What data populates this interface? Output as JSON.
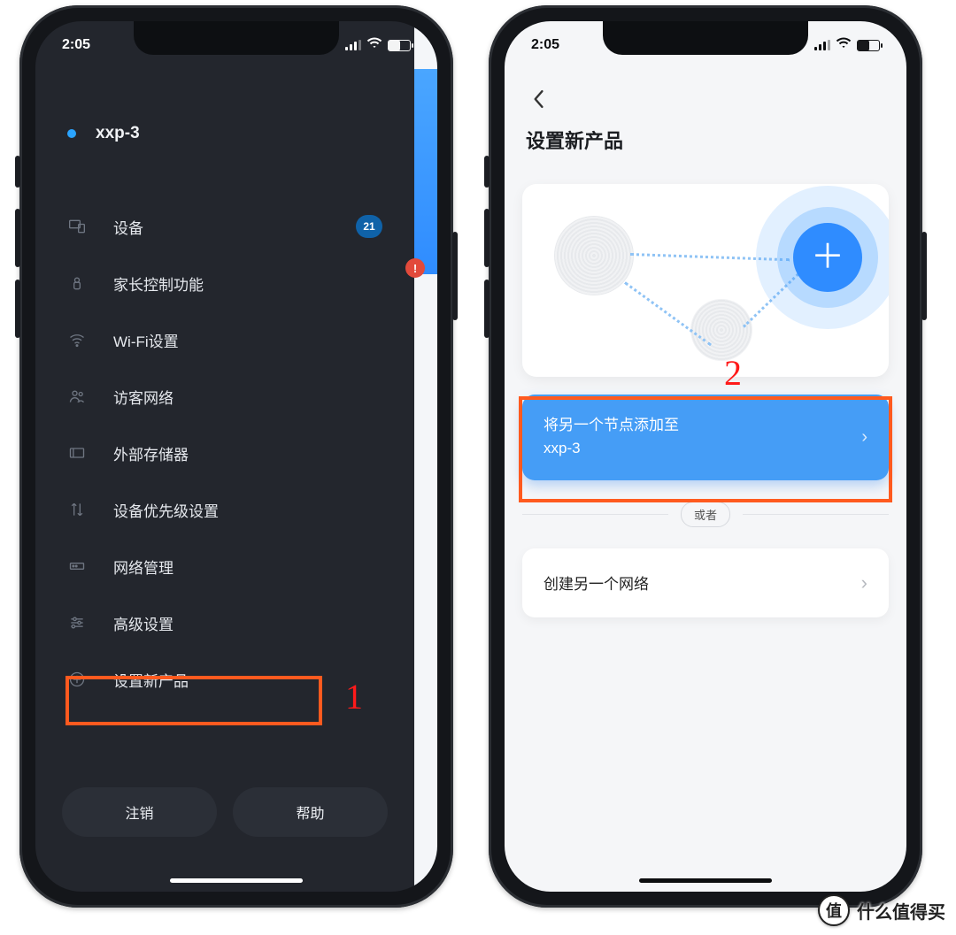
{
  "status": {
    "time": "2:05"
  },
  "left": {
    "network_name": "xxp-3",
    "menu": {
      "devices": "设备",
      "devices_count": "21",
      "parental": "家长控制功能",
      "wifi": "Wi-Fi设置",
      "guest": "访客网络",
      "storage": "外部存储器",
      "priority": "设备优先级设置",
      "netmgmt": "网络管理",
      "advanced": "高级设置",
      "setup_new": "设置新产品"
    },
    "buttons": {
      "logout": "注销",
      "help": "帮助"
    },
    "alert_icon": "!"
  },
  "right": {
    "title": "设置新产品",
    "add_node_line1": "将另一个节点添加至",
    "add_node_line2": "xxp-3",
    "or": "或者",
    "create_network": "创建另一个网络"
  },
  "annotations": {
    "one": "1",
    "two": "2"
  },
  "watermark": {
    "badge": "值",
    "text": "什么值得买"
  }
}
